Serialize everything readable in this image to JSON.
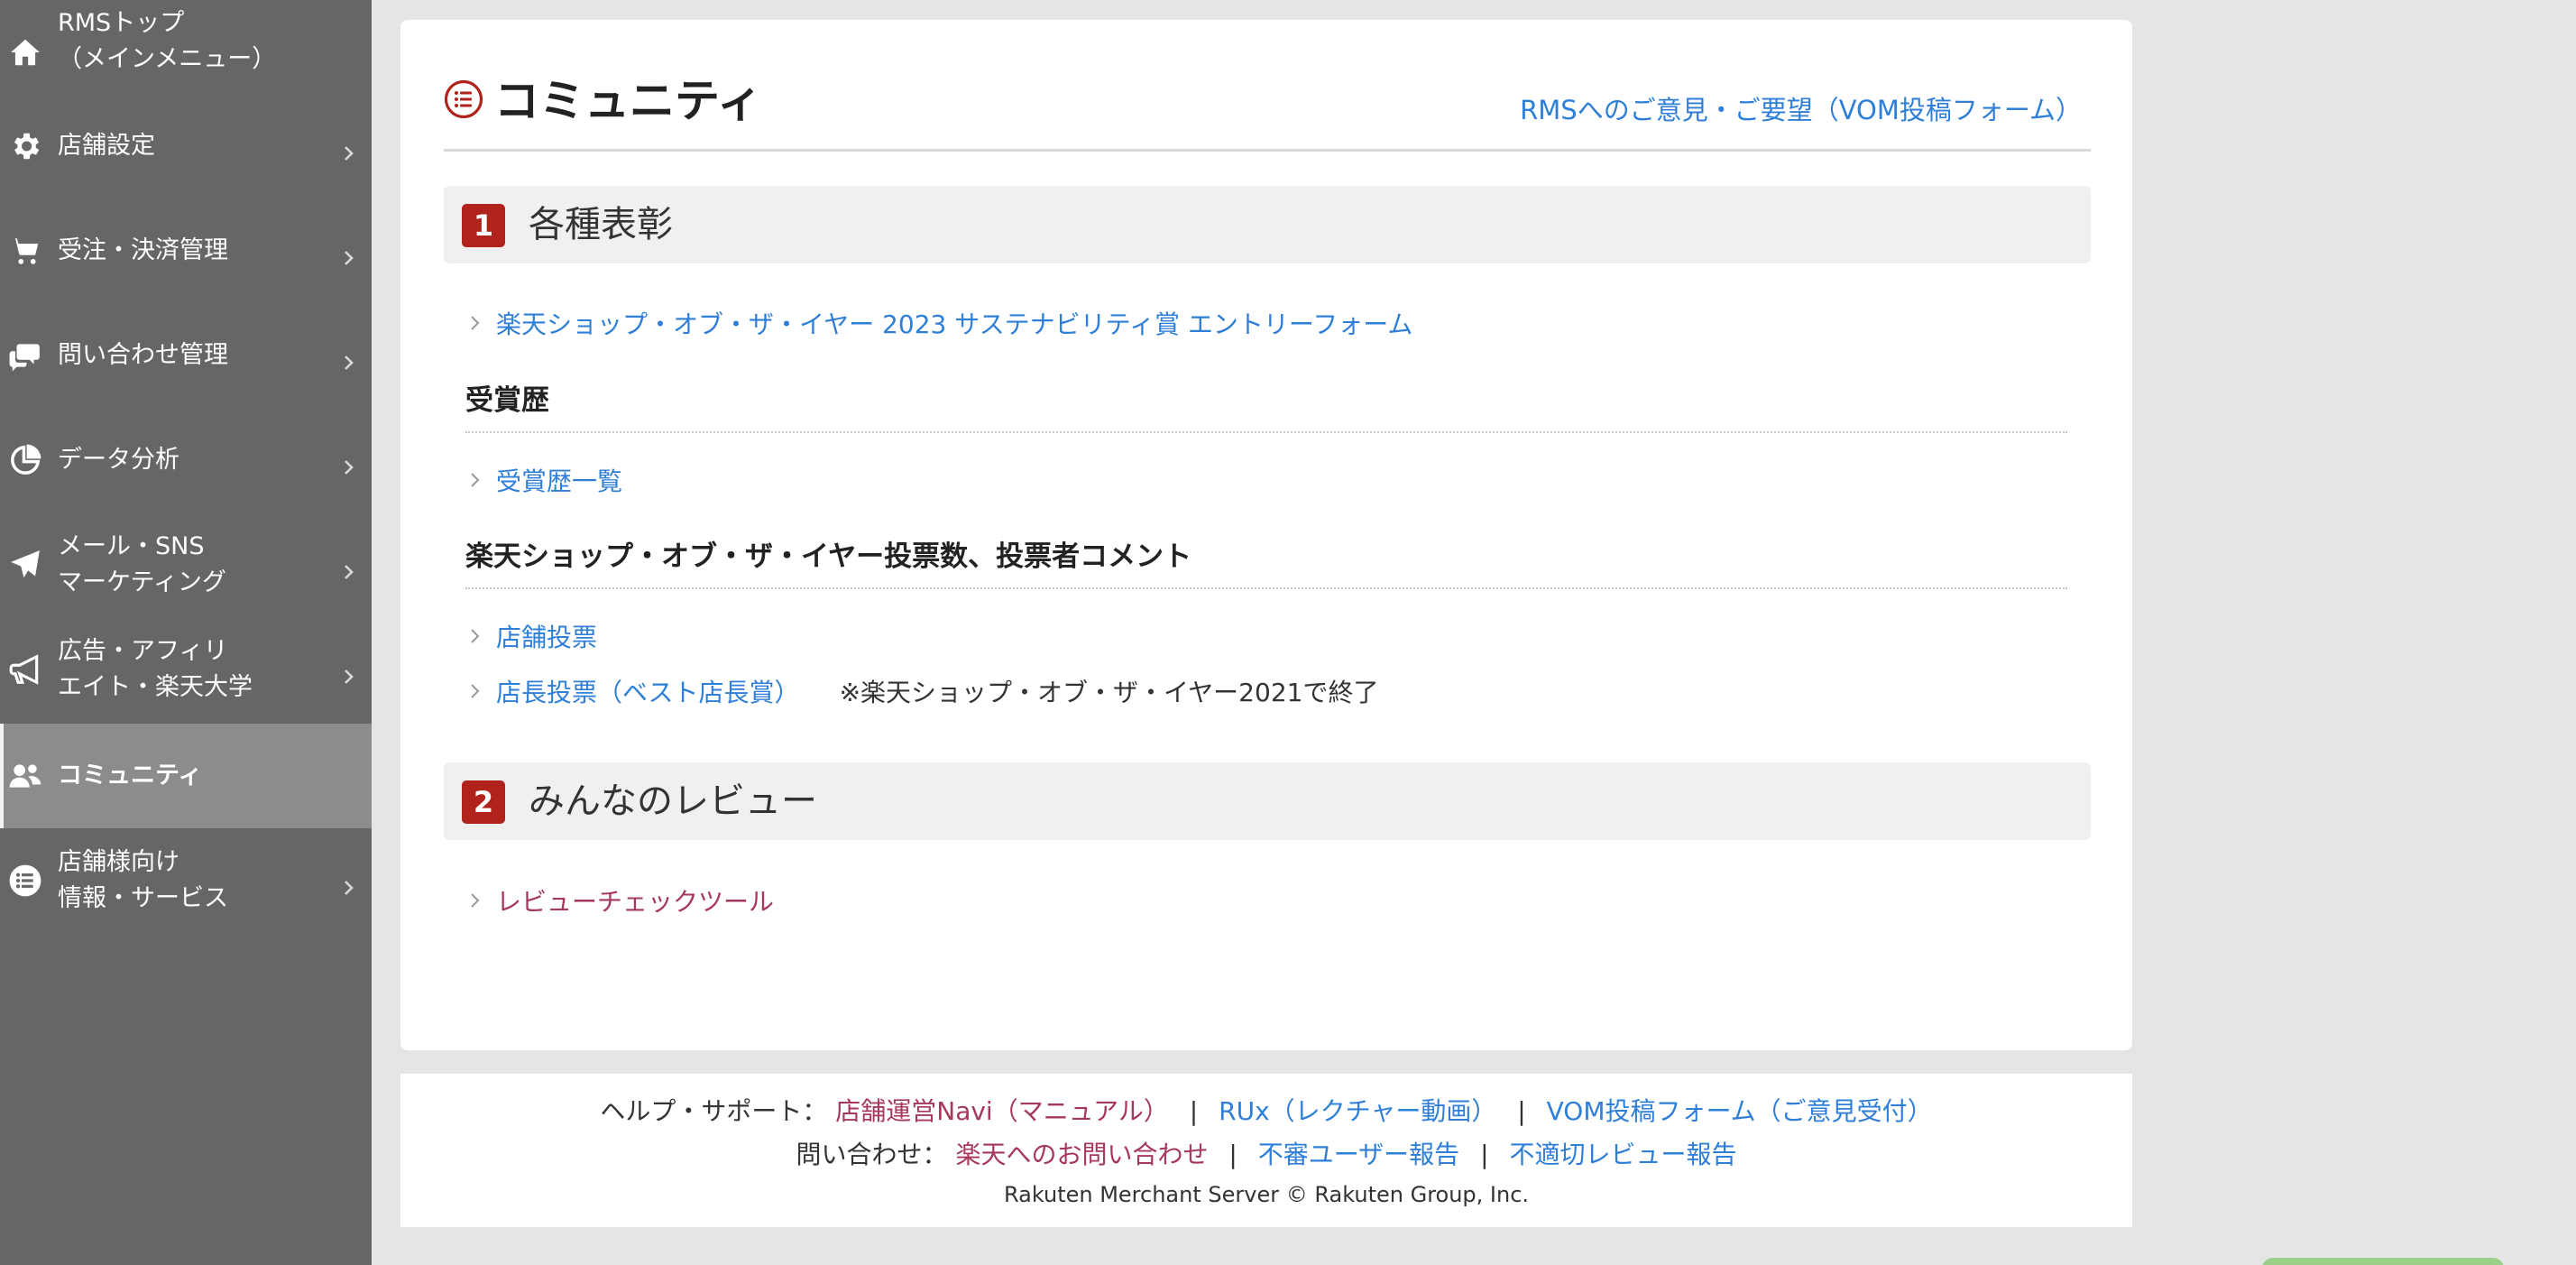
{
  "sidebar": {
    "items": [
      {
        "label": "RMSトップ\n（メインメニュー）",
        "icon": "home-icon",
        "has_chevron": false
      },
      {
        "label": "店舗設定",
        "icon": "gear-icon",
        "has_chevron": true
      },
      {
        "label": "受注・決済管理",
        "icon": "cart-icon",
        "has_chevron": true
      },
      {
        "label": "問い合わせ管理",
        "icon": "chat-icon",
        "has_chevron": true
      },
      {
        "label": "データ分析",
        "icon": "pie-chart-icon",
        "has_chevron": true
      },
      {
        "label": "メール・SNS\nマーケティング",
        "icon": "paper-plane-icon",
        "has_chevron": true
      },
      {
        "label": "広告・アフィリ\nエイト・楽天大学",
        "icon": "megaphone-icon",
        "has_chevron": true
      },
      {
        "label": "コミュニティ",
        "icon": "users-icon",
        "has_chevron": false,
        "active": true
      },
      {
        "label": "店舗様向け\n情報・サービス",
        "icon": "list-icon",
        "has_chevron": true
      }
    ]
  },
  "page": {
    "title": "コミュニティ",
    "feedback_link": "RMSへのご意見・ご要望（VOM投稿フォーム）"
  },
  "sections": [
    {
      "number": "1",
      "title": "各種表彰",
      "entry_link": "楽天ショップ・オブ・ザ・イヤー 2023 サステナビリティ賞 エントリーフォーム",
      "subsections": [
        {
          "heading": "受賞歴",
          "links": [
            {
              "label": "受賞歴一覧"
            }
          ]
        },
        {
          "heading": "楽天ショップ・オブ・ザ・イヤー投票数、投票者コメント",
          "links": [
            {
              "label": "店舗投票"
            },
            {
              "label": "店長投票（ベスト店長賞）",
              "note": "※楽天ショップ・オブ・ザ・イヤー2021で終了"
            }
          ]
        }
      ]
    },
    {
      "number": "2",
      "title": "みんなのレビュー",
      "links": [
        {
          "label": "レビューチェックツール"
        }
      ]
    }
  ],
  "footer": {
    "help_label": "ヘルプ・サポート：",
    "help_links": [
      "店舗運営Navi（マニュアル）",
      "RUx（レクチャー動画）",
      "VOM投稿フォーム（ご意見受付）"
    ],
    "contact_label": "問い合わせ：",
    "contact_links": [
      "楽天へのお問い合わせ",
      "不審ユーザー報告",
      "不適切レビュー報告"
    ],
    "separator": "|",
    "copyright": "Rakuten Merchant Server © Rakuten Group, Inc."
  },
  "colors": {
    "sidebar_bg": "#666666",
    "active_bg": "#8c8c8c",
    "link_blue": "#2f7fd8",
    "link_visited": "#a6385a",
    "section_badge": "#b0231c"
  }
}
